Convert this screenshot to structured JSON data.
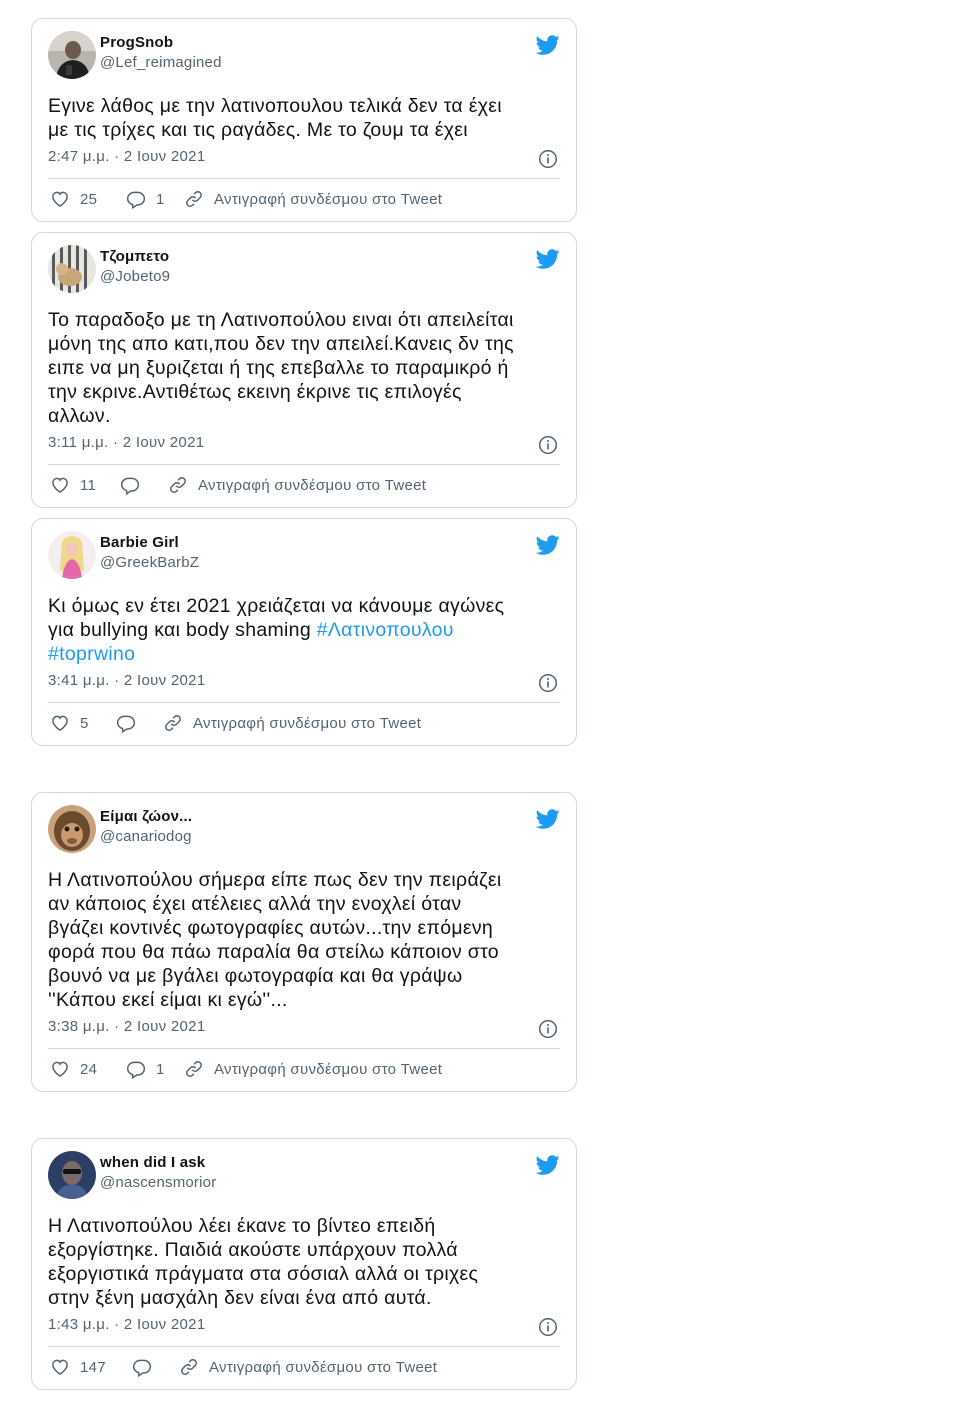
{
  "tweets": [
    {
      "name": "ProgSnob",
      "handle": "@Lef_reimagined",
      "text_lines": [
        "Εγινε λάθος με την λατινοπουλου τελικά δεν τα έχει",
        "με τις τρίχες και τις ραγάδες. Με το ζουμ τα έχει"
      ],
      "timestamp": "2:47 μ.μ. · 2 Ιουν 2021",
      "likes": "25",
      "replies": "1",
      "copy_link_label": "Αντιγραφή συνδέσμου στο Tweet"
    },
    {
      "name": "Τζομπετο",
      "handle": "@Jobeto9",
      "text_lines": [
        "Το παραδοξο με τη Λατινοπούλου ειναι ότι απειλείται",
        "μόνη της απο κατι,που δεν την απειλεί.Κανεις δν της",
        "ειπε να μη ξυριζεται ή της επεβαλλε το παραμικρό ή",
        "την εκρινε.Αντιθέτως εκεινη έκρινε τις επιλογές",
        "αλλων."
      ],
      "timestamp": "3:11 μ.μ. · 2 Ιουν 2021",
      "likes": "11",
      "replies": "",
      "copy_link_label": "Αντιγραφή συνδέσμου στο Tweet"
    },
    {
      "name": "Barbie Girl",
      "handle": "@GreekBarbZ",
      "text_line_1": "Κι όμως εν έτει 2021 χρειάζεται να κάνουμε αγώνες",
      "text_line_2_prefix": "για bullying και body shaming ",
      "hashtag_1": "#Λατινοπουλου",
      "hashtag_2": "#toprwino",
      "timestamp": "3:41 μ.μ. · 2 Ιουν 2021",
      "likes": "5",
      "replies": "",
      "copy_link_label": "Αντιγραφή συνδέσμου στο Tweet"
    },
    {
      "name": "Είμαι ζώον...",
      "handle": "@canariodog",
      "text_lines": [
        "Η Λατινοπούλου σήμερα είπε πως δεν την πειράζει",
        "αν κάποιος έχει ατέλειες αλλά την ενοχλεί όταν",
        "βγάζει κοντινές φωτογραφίες αυτών...την επόμενη",
        "φορά που θα πάω παραλία θα στείλω κάποιον στο",
        "βουνό να με βγάλει φωτογραφία και θα γράψω",
        "''Κάπου εκεί είμαι κι εγώ''..."
      ],
      "timestamp": "3:38 μ.μ. · 2 Ιουν 2021",
      "likes": "24",
      "replies": "1",
      "copy_link_label": "Αντιγραφή συνδέσμου στο Tweet"
    },
    {
      "name": "when did I ask",
      "handle": "@nascensmorior",
      "text_lines": [
        "Η Λατινοπούλου λέει έκανε το βίντεο επειδή",
        "εξοργίστηκε. Παιδιά ακούστε υπάρχουν πολλά",
        "εξοργιστικά πράγματα στα σόσιαλ αλλά οι τριχες",
        "στην ξένη μασχάλη δεν είναι ένα από αυτά."
      ],
      "timestamp": "1:43 μ.μ. · 2 Ιουν 2021",
      "likes": "147",
      "replies": "",
      "copy_link_label": "Αντιγραφή συνδέσμου στο Tweet"
    }
  ],
  "icons": {
    "brand": "twitter-bird-icon",
    "like": "heart-icon",
    "reply": "reply-bubble-icon",
    "copy_link": "link-icon",
    "info": "info-icon"
  },
  "colors": {
    "brand_blue": "#1d9bf0",
    "text": "#0f1419",
    "muted": "#536471",
    "border": "#cfd9de"
  }
}
